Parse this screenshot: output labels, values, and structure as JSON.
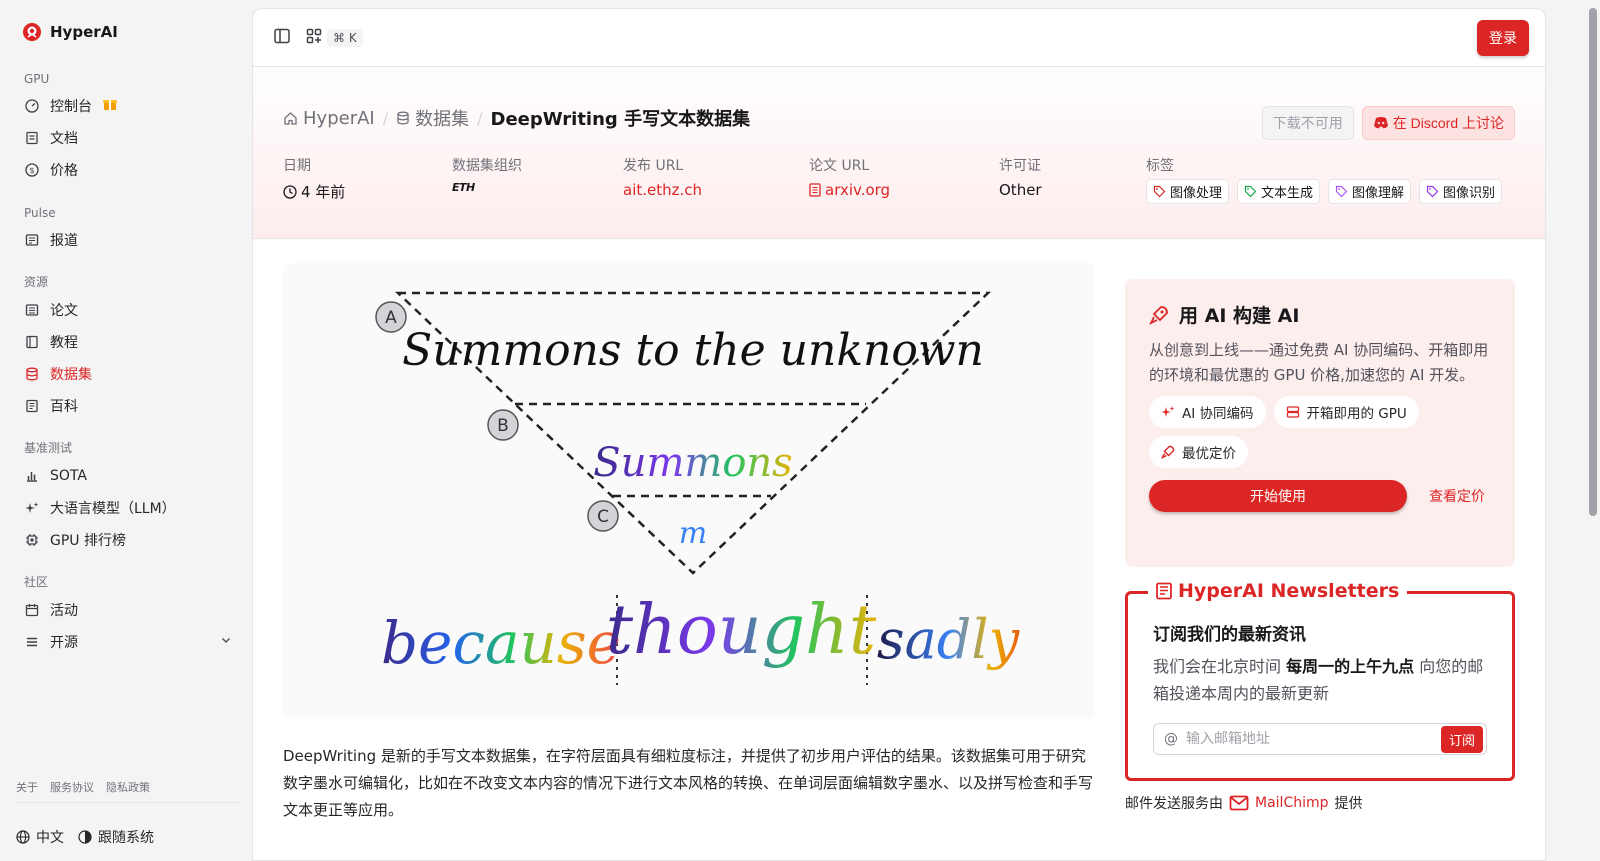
{
  "brand": {
    "name": "HyperAI"
  },
  "sidebar": {
    "sections": [
      {
        "title": "GPU",
        "items": [
          {
            "label": "控制台",
            "icon": "dashboard-icon"
          },
          {
            "label": "文档",
            "icon": "doc-icon"
          },
          {
            "label": "价格",
            "icon": "dollar-icon"
          }
        ]
      },
      {
        "title": "Pulse",
        "items": [
          {
            "label": "报道",
            "icon": "news-icon"
          }
        ]
      },
      {
        "title": "资源",
        "items": [
          {
            "label": "论文",
            "icon": "paper-icon"
          },
          {
            "label": "教程",
            "icon": "book-icon"
          },
          {
            "label": "数据集",
            "icon": "database-icon"
          },
          {
            "label": "百科",
            "icon": "wiki-icon"
          }
        ]
      },
      {
        "title": "基准测试",
        "items": [
          {
            "label": "SOTA",
            "icon": "chart-icon"
          },
          {
            "label": "大语言模型（LLM）",
            "icon": "sparkle-icon"
          },
          {
            "label": "GPU 排行榜",
            "icon": "cpu-icon"
          }
        ]
      },
      {
        "title": "社区",
        "items": [
          {
            "label": "活动",
            "icon": "calendar-icon"
          },
          {
            "label": "开源",
            "icon": "list-icon"
          }
        ]
      }
    ],
    "footer_links": [
      "关于",
      "服务协议",
      "隐私政策"
    ],
    "language": "中文",
    "theme": "跟随系统"
  },
  "topbar": {
    "shortcut": "⌘ K",
    "login": "登录"
  },
  "breadcrumb": {
    "home": "HyperAI",
    "section": "数据集",
    "current": "DeepWriting 手写文本数据集"
  },
  "actions": {
    "download": "下载不可用",
    "discord": "在 Discord 上讨论"
  },
  "meta": {
    "date_label": "日期",
    "date_value": "4 年前",
    "org_label": "数据集组织",
    "org_value": "ETH",
    "release_label": "发布 URL",
    "release_value": "ait.ethz.ch",
    "paper_label": "论文 URL",
    "paper_value": "arxiv.org",
    "license_label": "许可证",
    "license_value": "Other",
    "tags_label": "标签",
    "tags": [
      {
        "label": "图像处理",
        "color": "#dc2626"
      },
      {
        "label": "文本生成",
        "color": "#16a34a"
      },
      {
        "label": "图像理解",
        "color": "#a855f7"
      },
      {
        "label": "图像识别",
        "color": "#9333ea"
      }
    ]
  },
  "figure": {
    "labels": [
      "A",
      "B",
      "C"
    ],
    "words": [
      "Summons to the unknown",
      "Summons",
      "m",
      "because",
      "thought",
      "sadly"
    ]
  },
  "description": "DeepWriting 是新的手写文本数据集，在字符层面具有细粒度标注，并提供了初步用户评估的结果。该数据集可用于研究数字墨水可编辑化，比如在不改变文本内容的情况下进行文本风格的转换、在单词层面编辑数字墨水、以及拼写检查和手写文本更正等应用。",
  "promo": {
    "title": "用 AI 构建 AI",
    "text": "从创意到上线——通过免费 AI 协同编码、开箱即用的环境和最优惠的 GPU 价格,加速您的 AI 开发。",
    "chips": [
      "AI 协同编码",
      "开箱即用的 GPU",
      "最优定价"
    ],
    "start": "开始使用",
    "pricing": "查看定价"
  },
  "newsletter": {
    "title": "HyperAI Newsletters",
    "heading": "订阅我们的最新资讯",
    "text_pre": "我们会在北京时间 ",
    "text_bold": "每周一的上午九点",
    "text_post": " 向您的邮箱投递本周内的最新更新",
    "placeholder": "输入邮箱地址",
    "subscribe": "订阅",
    "note_pre": "邮件发送服务由",
    "note_brand": "MailChimp",
    "note_post": "提供"
  },
  "colors": {
    "accent": "#dc2626"
  }
}
